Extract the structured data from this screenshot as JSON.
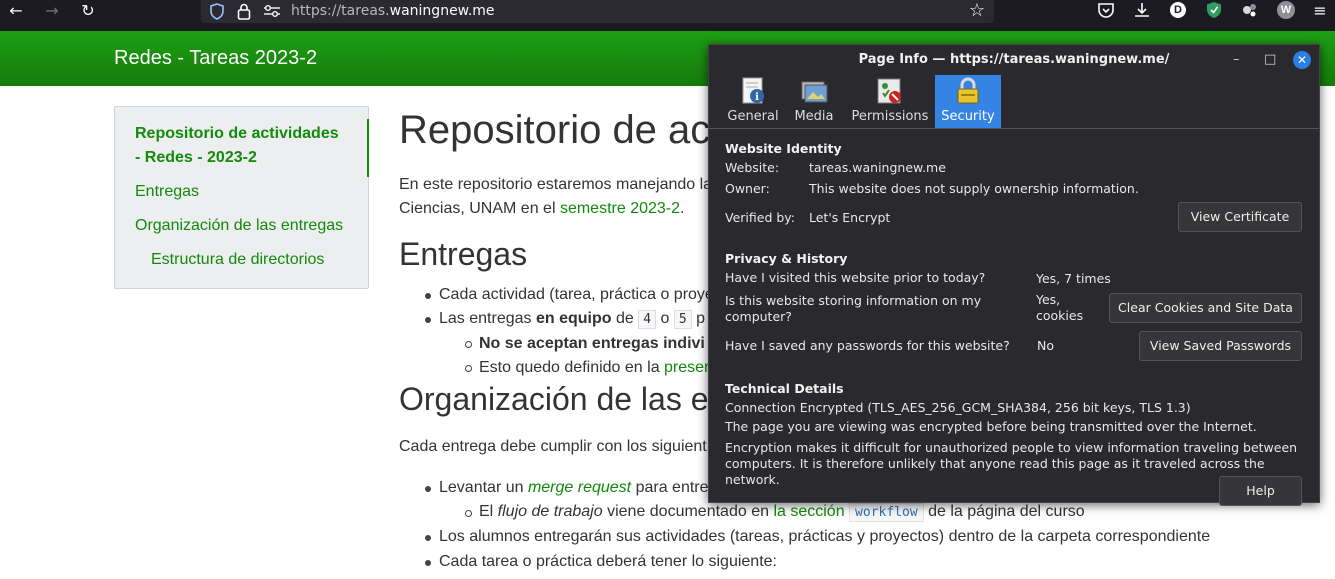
{
  "browser": {
    "url_host_prefix": "https://tareas.",
    "url_host_main": "waningnew.me",
    "ext_d_label": "D",
    "ext_w_label": "W"
  },
  "page": {
    "site_title": "Redes - Tareas 2023-2",
    "sidebar": {
      "items": [
        {
          "label": "Repositorio de actividades - Redes - 2023-2",
          "line1": "Repositorio de actividades",
          "line2": "- Redes - 2023-2"
        },
        {
          "label": "Entregas"
        },
        {
          "label": "Organización de las entregas"
        },
        {
          "label": "Estructura de directorios"
        }
      ]
    },
    "main": {
      "h1": "Repositorio de ac",
      "intro_line1": "En este repositorio estaremos manejando la",
      "intro_line2_prefix": "Ciencias, UNAM en el ",
      "intro_link": "semestre 2023-2",
      "intro_line2_suffix": ".",
      "h2_entregas": "Entregas",
      "bullet1": "Cada actividad (tarea, práctica o proye",
      "bullet2_prefix": "Las entregas ",
      "bullet2_bold": "en equipo",
      "bullet2_mid": " de ",
      "code4": "4",
      "bullet2_o": " o ",
      "code5": "5",
      "bullet2_tail": " p",
      "sub1_bold": "No se aceptan entregas indivi",
      "sub2_prefix": "Esto quedo definido en la ",
      "sub2_link": "preser",
      "h2_org": "Organización de las e",
      "org_para": "Cada entrega debe cumplir con los siguient",
      "li1_prefix": "Levantar un ",
      "li1_link": "merge request",
      "li1_suffix": " para entre",
      "li1_sub_prefix": "El ",
      "li1_sub_em": "flujo de trabajo",
      "li1_sub_mid": " viene documentado en ",
      "li1_sub_link": "la sección",
      "li1_sub_code": "workflow",
      "li1_sub_suffix": " de la página del curso",
      "li2": "Los alumnos entregarán sus actividades (tareas, prácticas y proyectos) dentro de la carpeta correspondiente",
      "li3": "Cada tarea o práctica deberá tener lo siguiente:"
    }
  },
  "dialog": {
    "title": "Page Info — https://tareas.waningnew.me/",
    "minimize": "–",
    "maximize": "□",
    "close": "✕",
    "tabs": [
      {
        "label": "General",
        "icon": "general-info-icon"
      },
      {
        "label": "Media",
        "icon": "media-icon"
      },
      {
        "label": "Permissions",
        "icon": "permissions-icon"
      },
      {
        "label": "Security",
        "icon": "padlock-icon",
        "active": true
      }
    ],
    "identity": {
      "heading": "Website Identity",
      "website_label": "Website:",
      "website_value": "tareas.waningnew.me",
      "owner_label": "Owner:",
      "owner_value": "This website does not supply ownership information.",
      "verified_label": "Verified by:",
      "verified_value": "Let's Encrypt",
      "view_cert": "View Certificate"
    },
    "privacy": {
      "heading": "Privacy & History",
      "q1": "Have I visited this website prior to today?",
      "a1": "Yes, 7 times",
      "q2_line1": "Is this website storing information on my",
      "q2_line2": "computer?",
      "a2_line1": "Yes,",
      "a2_line2": "cookies",
      "clear_cookies": "Clear Cookies and Site Data",
      "q3": "Have I saved any passwords for this website?",
      "a3": "No",
      "view_passwords": "View Saved Passwords"
    },
    "technical": {
      "heading": "Technical Details",
      "line1": "Connection Encrypted (TLS_AES_256_GCM_SHA384, 256 bit keys, TLS 1.3)",
      "line2": "The page you are viewing was encrypted before being transmitted over the Internet.",
      "line3": "Encryption makes it difficult for unauthorized people to view information traveling between",
      "line4": "computers. It is therefore unlikely that anyone read this page as it traveled across the network.",
      "help": "Help"
    }
  }
}
